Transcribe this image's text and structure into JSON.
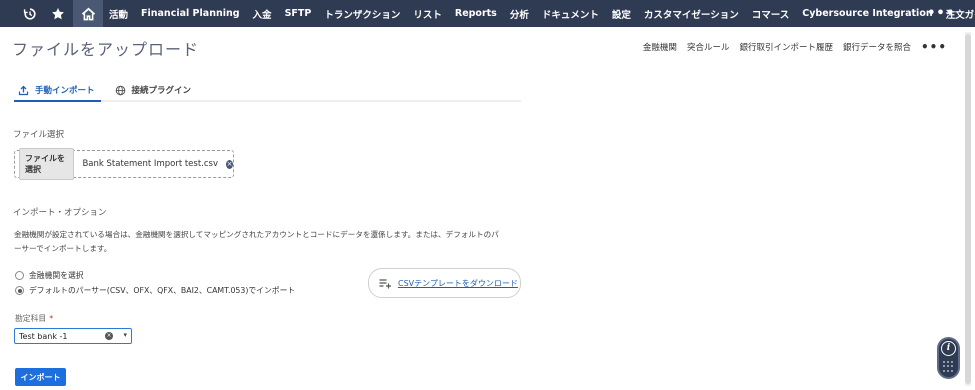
{
  "nav": {
    "icons": [
      "history-icon",
      "star-icon",
      "home-icon"
    ],
    "items": [
      "活動",
      "Financial Planning",
      "入金",
      "SFTP",
      "トランザクション",
      "リスト",
      "Reports",
      "分析",
      "ドキュメント",
      "設定",
      "カスタマイゼーション",
      "コマース",
      "Cybersource Integration",
      "注文ガイド"
    ],
    "more": "•••"
  },
  "header": {
    "title": "ファイルをアップロード",
    "links": [
      "金融機関",
      "突合ルール",
      "銀行取引インポート履歴",
      "銀行データを照合"
    ],
    "more": "•••"
  },
  "tabs": [
    {
      "label": "手動インポート",
      "active": true
    },
    {
      "label": "接続プラグイン",
      "active": false
    }
  ],
  "file_section": {
    "label": "ファイル選択",
    "button": "ファイルを選択",
    "file_name": "Bank Statement Import test.csv",
    "clear": "×"
  },
  "import_options": {
    "label": "インポート・オプション",
    "description_line1": "金融機関が設定されている場合は、金融機関を選択してマッピングされたアカウントとコードにデータを還係します。または、デフォルトのパ",
    "description_line2": "ーサーでインポートします。",
    "radio1": "金融機関を選択",
    "radio2": "デフォルトのパーサー(CSV、OFX、QFX、BAI2、CAMT.053)でインポート",
    "selected": "radio2",
    "csv_button": "CSVテンプレートをダウンロード"
  },
  "account": {
    "label": "勘定科目",
    "required": "*",
    "value": "Test bank -1",
    "clear": "×",
    "caret": "▾"
  },
  "import_button": "インポート",
  "help": {
    "icon": "i"
  },
  "colors": {
    "nav_bg": "#2f3b52",
    "accent": "#1c6fdc",
    "link": "#1f5fb3"
  }
}
